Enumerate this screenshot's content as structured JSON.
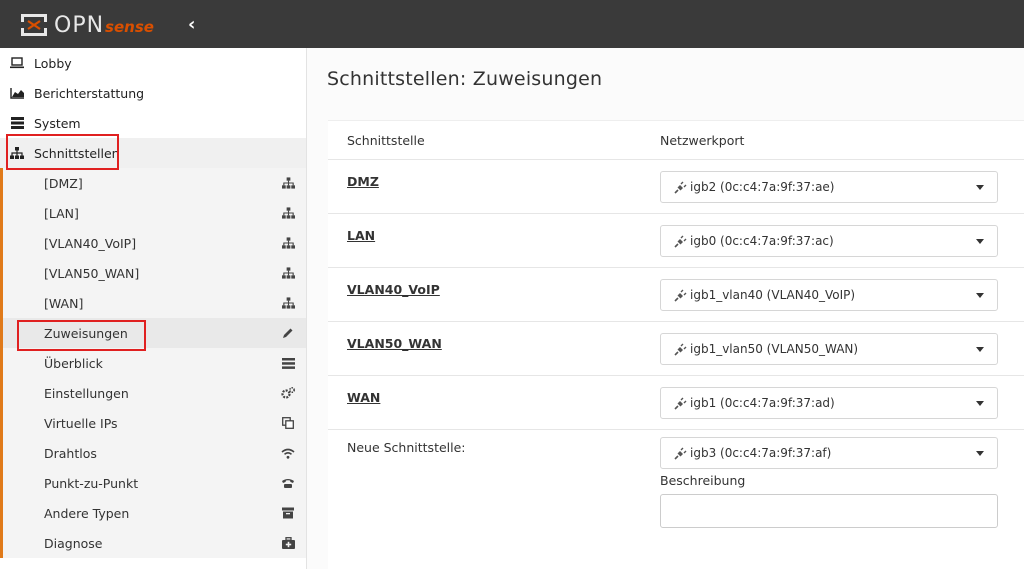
{
  "header": {
    "logo_text": "OPN",
    "logo_suffix": "sense",
    "collapse_symbol": "‹"
  },
  "sidebar": {
    "items": [
      {
        "label": "Lobby",
        "icon": "laptop-icon"
      },
      {
        "label": "Berichterstattung",
        "icon": "area-chart-icon"
      },
      {
        "label": "System",
        "icon": "server-icon"
      },
      {
        "label": "Schnittstellen",
        "icon": "sitemap-icon"
      }
    ],
    "sub_items": [
      {
        "label": "[DMZ]",
        "icon": "sitemap-icon"
      },
      {
        "label": "[LAN]",
        "icon": "sitemap-icon"
      },
      {
        "label": "[VLAN40_VoIP]",
        "icon": "sitemap-icon"
      },
      {
        "label": "[VLAN50_WAN]",
        "icon": "sitemap-icon"
      },
      {
        "label": "[WAN]",
        "icon": "sitemap-icon"
      },
      {
        "label": "Zuweisungen",
        "icon": "pencil-icon"
      },
      {
        "label": "Überblick",
        "icon": "list-icon"
      },
      {
        "label": "Einstellungen",
        "icon": "cogs-icon"
      },
      {
        "label": "Virtuelle IPs",
        "icon": "clone-icon"
      },
      {
        "label": "Drahtlos",
        "icon": "wifi-icon"
      },
      {
        "label": "Punkt-zu-Punkt",
        "icon": "phone-icon"
      },
      {
        "label": "Andere Typen",
        "icon": "archive-icon"
      },
      {
        "label": "Diagnose",
        "icon": "medkit-icon"
      }
    ]
  },
  "main": {
    "title": "Schnittstellen: Zuweisungen",
    "col_interface": "Schnittstelle",
    "col_port": "Netzwerkport",
    "rows": [
      {
        "name": "DMZ",
        "port": "igb2 (0c:c4:7a:9f:37:ae)"
      },
      {
        "name": "LAN",
        "port": "igb0 (0c:c4:7a:9f:37:ac)"
      },
      {
        "name": "VLAN40_VoIP",
        "port": "igb1_vlan40 (VLAN40_VoIP)"
      },
      {
        "name": "VLAN50_WAN",
        "port": "igb1_vlan50 (VLAN50_WAN)"
      },
      {
        "name": "WAN",
        "port": "igb1 (0c:c4:7a:9f:37:ad)"
      }
    ],
    "new_interface_label": "Neue Schnittstelle:",
    "new_interface_port": "igb3 (0c:c4:7a:9f:37:af)",
    "description_label": "Beschreibung",
    "description_value": ""
  },
  "colors": {
    "topbar": "#3a3a3a",
    "accent": "#e07a1a",
    "highlight": "#e02020"
  }
}
